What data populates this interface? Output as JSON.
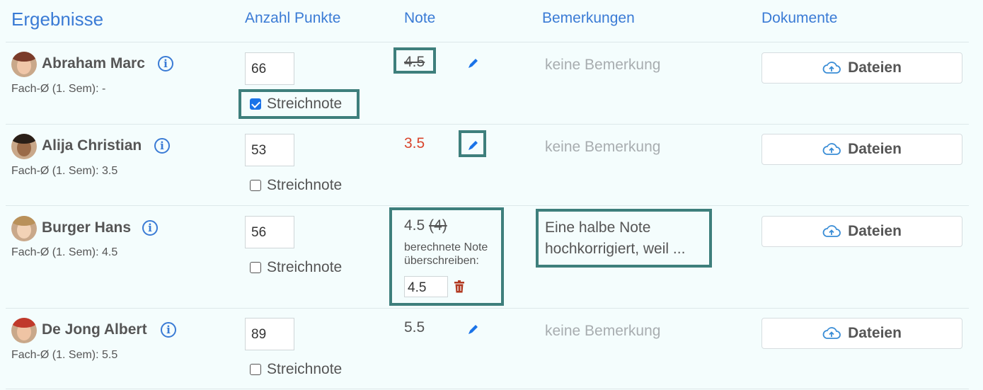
{
  "headers": {
    "results": "Ergebnisse",
    "points": "Anzahl Punkte",
    "grade": "Note",
    "remarks": "Bemerkungen",
    "documents": "Dokumente"
  },
  "students": [
    {
      "name": "Abraham Marc",
      "avg": "Fach-Ø (1. Sem): -",
      "points": "66",
      "streichnote_label": "Streichnote",
      "streichnote_checked": true,
      "grade": "4.5",
      "remark": "keine Bemerkung",
      "files_label": "Dateien"
    },
    {
      "name": "Alija Christian",
      "avg": "Fach-Ø (1. Sem): 3.5",
      "points": "53",
      "streichnote_label": "Streichnote",
      "streichnote_checked": false,
      "grade": "3.5",
      "remark": "keine Bemerkung",
      "files_label": "Dateien"
    },
    {
      "name": "Burger Hans",
      "avg": "Fach-Ø (1. Sem): 4.5",
      "points": "56",
      "streichnote_label": "Streichnote",
      "streichnote_checked": false,
      "grade": "4.5",
      "grade_calculated": "(4)",
      "override_label_1": "berechnete Note",
      "override_label_2": "überschreiben:",
      "override_value": "4.5",
      "remark_line1": "Eine halbe Note",
      "remark_line2": "hochkorrigiert, weil ...",
      "files_label": "Dateien"
    },
    {
      "name": "De Jong Albert",
      "avg": "Fach-Ø (1. Sem): 5.5",
      "points": "89",
      "streichnote_label": "Streichnote",
      "streichnote_checked": false,
      "grade": "5.5",
      "remark": "keine Bemerkung",
      "files_label": "Dateien"
    }
  ],
  "colors": {
    "accent": "#3a7bd5",
    "highlight": "#3e7f7c",
    "danger": "#d9452c",
    "muted": "#a8adb0"
  }
}
